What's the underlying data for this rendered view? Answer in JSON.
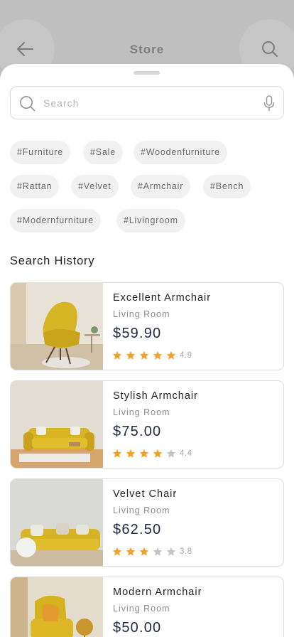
{
  "background_header": {
    "title": "Store"
  },
  "search": {
    "placeholder": "Search",
    "value": ""
  },
  "tags": [
    "#Furniture",
    "#Sale",
    "#Woodenfurniture",
    "#Rattan",
    "#Velvet",
    "#Armchair",
    "#Bench",
    "#Modernfurniture",
    "#Livingroom"
  ],
  "history": {
    "title": "Search History",
    "items": [
      {
        "name": "Excellent Armchair",
        "category": "Living Room",
        "price": "$59.90",
        "rating": "4.9",
        "stars": 5
      },
      {
        "name": "Stylish Armchair",
        "category": "Living Room",
        "price": "$75.00",
        "rating": "4.4",
        "stars": 4
      },
      {
        "name": "Velvet Chair",
        "category": "Living Room",
        "price": "$62.50",
        "rating": "3.8",
        "stars": 3
      },
      {
        "name": "Modern Armchair",
        "category": "Living Room",
        "price": "$50.00",
        "rating": "",
        "stars": 0
      }
    ]
  },
  "colors": {
    "star_filled": "#f0a22e",
    "star_empty": "#c4c4c4",
    "price": "#1f2a44",
    "accent_yellow": "#d9b521"
  },
  "icons": {
    "back": "arrow-left-icon",
    "search": "search-icon",
    "mic": "microphone-icon",
    "star": "star-icon"
  }
}
